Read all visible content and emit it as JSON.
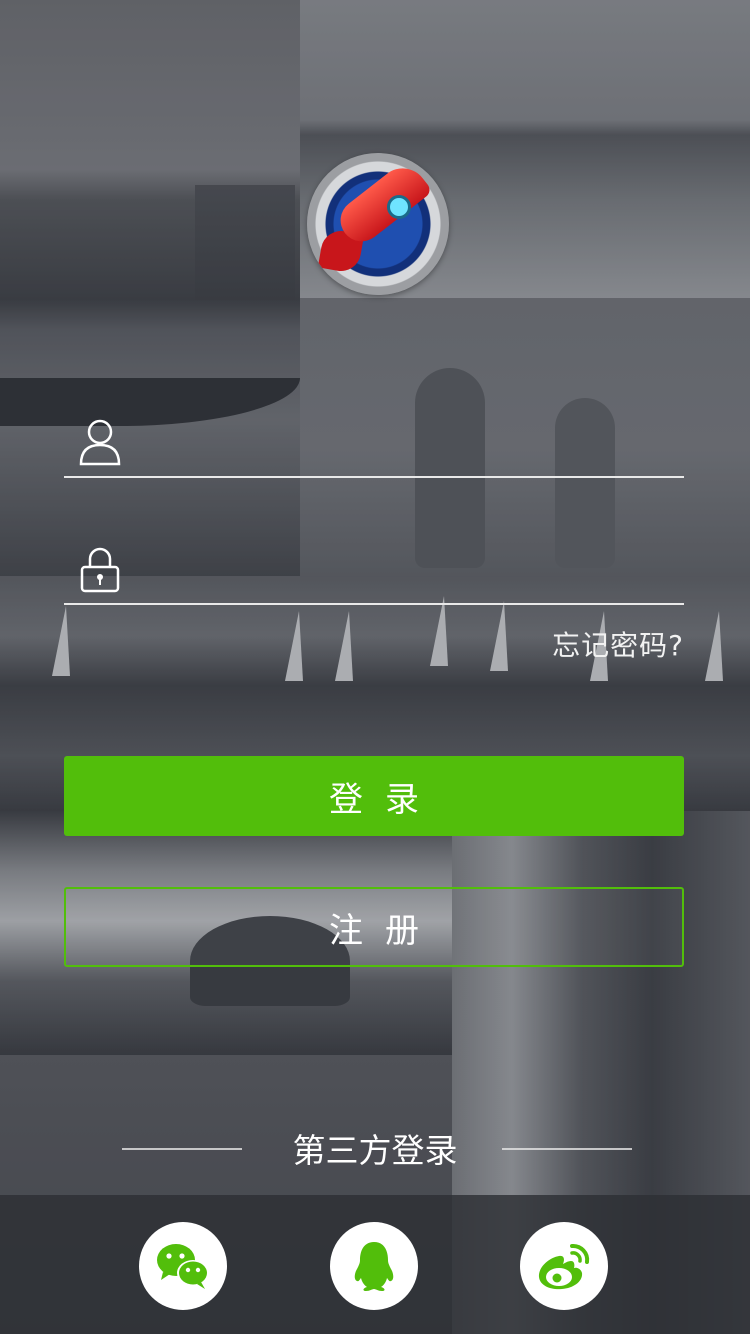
{
  "login_form": {
    "username_placeholder": "",
    "password_placeholder": "",
    "forgot_password": "忘记密码?",
    "login_label": "登录",
    "register_label": "注册"
  },
  "third_party": {
    "title": "第三方登录",
    "providers": [
      "wechat",
      "qq",
      "weibo"
    ]
  },
  "icons": {
    "app_logo": "rocket-logo-icon",
    "username": "user-icon",
    "password": "lock-icon",
    "wechat": "wechat-icon",
    "qq": "qq-penguin-icon",
    "weibo": "weibo-icon"
  },
  "colors": {
    "accent": "#52be0b",
    "input_line": "#e9e9e9",
    "social_bar": "#2d2f34"
  }
}
